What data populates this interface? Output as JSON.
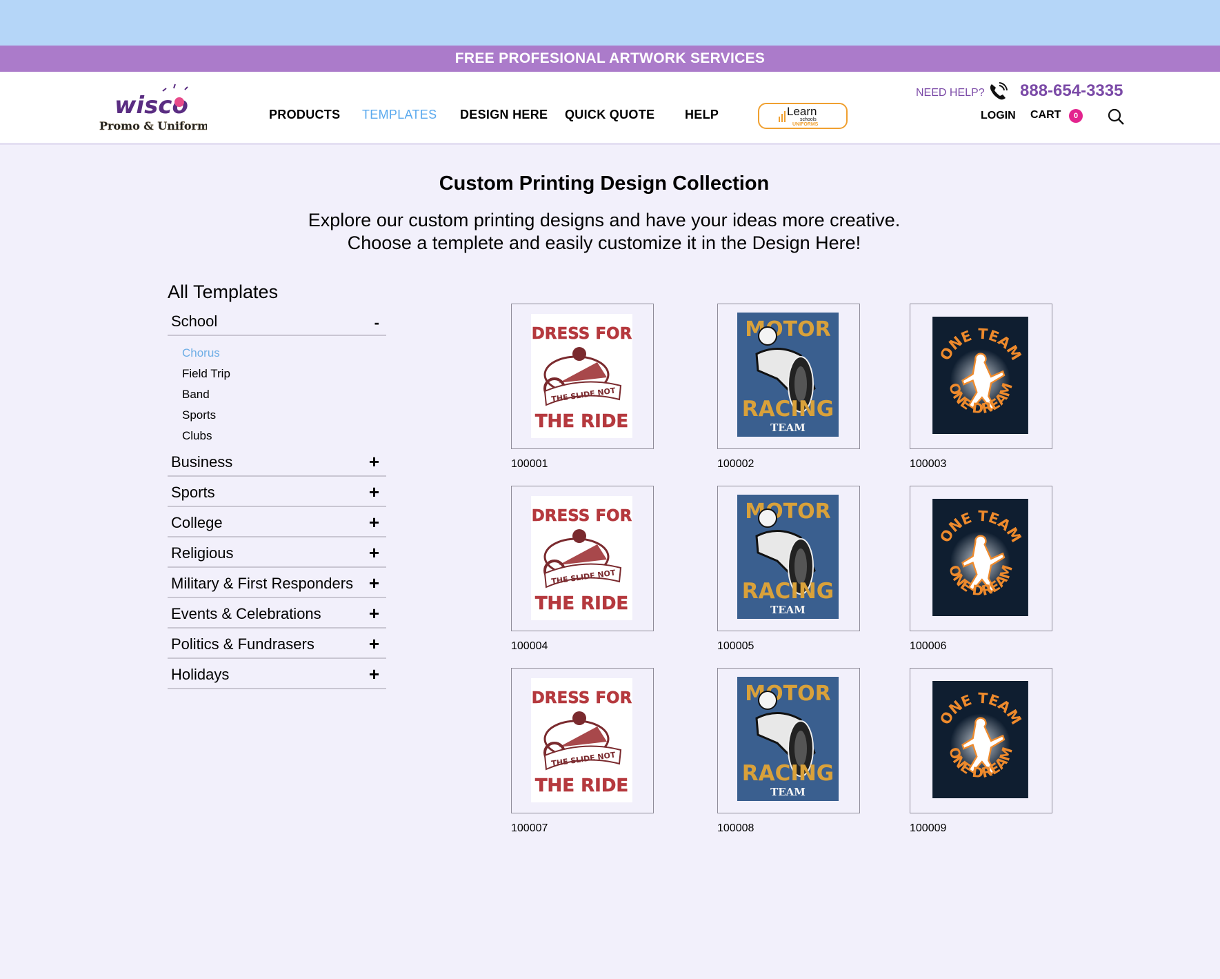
{
  "promo_banner": "FREE PROFESIONAL ARTWORK SERVICES",
  "logo": {
    "brand": "wisco",
    "tagline": "Promo & Uniform"
  },
  "nav": {
    "items": [
      {
        "label": "PRODUCTS",
        "active": false
      },
      {
        "label": "TEMPLATES",
        "active": true
      },
      {
        "label": "DESIGN HERE",
        "active": false
      },
      {
        "label": "QUICK QUOTE",
        "active": false
      },
      {
        "label": "HELP",
        "active": false
      }
    ],
    "learn_button": {
      "text_main": "Learn",
      "text_small": "schools",
      "text_sub": "UNIFORMS"
    }
  },
  "utility": {
    "need_help": "NEED HELP?",
    "phone": "888-654-3335",
    "login": "LOGIN",
    "cart": "CART",
    "cart_count": "0"
  },
  "page": {
    "title": "Custom Printing Design Collection",
    "intro_line1": "Explore our custom printing designs and have your ideas more creative.",
    "intro_line2": "Choose a templete and easily customize it in the Design Here!"
  },
  "sidebar": {
    "title": "All Templates",
    "categories": [
      {
        "label": "School",
        "toggle": "-",
        "expanded": true,
        "sub": [
          {
            "label": "Chorus",
            "active": true
          },
          {
            "label": "Field Trip",
            "active": false
          },
          {
            "label": "Band",
            "active": false
          },
          {
            "label": "Sports",
            "active": false
          },
          {
            "label": "Clubs",
            "active": false
          }
        ]
      },
      {
        "label": "Business",
        "toggle": "+"
      },
      {
        "label": "Sports",
        "toggle": "+"
      },
      {
        "label": "College",
        "toggle": "+"
      },
      {
        "label": "Religious",
        "toggle": "+"
      },
      {
        "label": "Military & First Responders",
        "toggle": "+"
      },
      {
        "label": "Events & Celebrations",
        "toggle": "+"
      },
      {
        "label": "Politics & Fundrasers",
        "toggle": "+"
      },
      {
        "label": "Holidays",
        "toggle": "+"
      }
    ]
  },
  "designs": {
    "dress": {
      "top": "DRESS FOR",
      "banner": "THE SLIDE NOT",
      "bottom": "THE RIDE"
    },
    "motor": {
      "top": "MOTOR",
      "middle": "RACING",
      "bottom": "TEAM"
    },
    "team": {
      "top": "ONE TEAM",
      "bottom": "ONE DREAM"
    }
  },
  "templates": [
    {
      "id": "100001",
      "design": "dress"
    },
    {
      "id": "100002",
      "design": "motor"
    },
    {
      "id": "100003",
      "design": "team"
    },
    {
      "id": "100004",
      "design": "dress"
    },
    {
      "id": "100005",
      "design": "motor"
    },
    {
      "id": "100006",
      "design": "team"
    },
    {
      "id": "100007",
      "design": "dress"
    },
    {
      "id": "100008",
      "design": "motor"
    },
    {
      "id": "100009",
      "design": "team"
    }
  ],
  "colors": {
    "top_band": "#b5d6f8",
    "promo_bar": "#ab7bca",
    "page_bg": "#f2f0fb",
    "accent_purple": "#7b4aa7",
    "active_link": "#5aa9ee",
    "cart_badge": "#e3248e",
    "dress_red": "#b5393e",
    "motor_blue": "#3a5f8f",
    "motor_gold": "#d9a13a",
    "team_navy": "#0f1e30",
    "team_orange": "#ee8a2c"
  }
}
